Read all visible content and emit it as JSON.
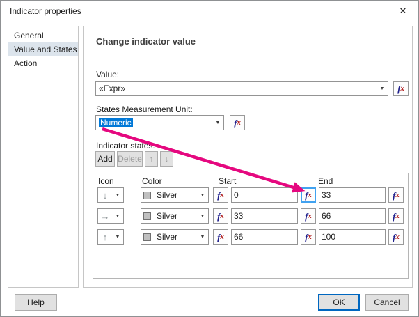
{
  "dialog": {
    "title": "Indicator properties"
  },
  "icons": {
    "close": "✕",
    "dropdown_arrow": "▼",
    "move_up": "↑",
    "move_down": "↓"
  },
  "sidebar": {
    "items": [
      {
        "label": "General"
      },
      {
        "label": "Value and States"
      },
      {
        "label": "Action"
      }
    ]
  },
  "main": {
    "heading": "Change indicator value",
    "value": {
      "label": "Value:",
      "text": "«Expr»"
    },
    "unit": {
      "label": "States Measurement Unit:",
      "value": "Numeric"
    },
    "states": {
      "label": "Indicator states:",
      "add_label": "Add",
      "delete_label": "Delete"
    },
    "table": {
      "headers": {
        "icon": "Icon",
        "color": "Color",
        "start": "Start",
        "end": "End"
      },
      "rows": [
        {
          "icon_glyph": "↓",
          "color": "Silver",
          "start": "0",
          "end": "33"
        },
        {
          "icon_glyph": "→",
          "color": "Silver",
          "start": "33",
          "end": "66"
        },
        {
          "icon_glyph": "↑",
          "color": "Silver",
          "start": "66",
          "end": "100"
        }
      ]
    },
    "fx": {
      "f": "f",
      "x": "x"
    }
  },
  "footer": {
    "help_label": "Help",
    "ok_label": "OK",
    "cancel_label": "Cancel"
  },
  "colors": {
    "selection": "#0078d7",
    "annotation_arrow": "#e5087f",
    "silver_swatch": "#c0c0c0",
    "focus_highlight": "#41a2f0"
  }
}
